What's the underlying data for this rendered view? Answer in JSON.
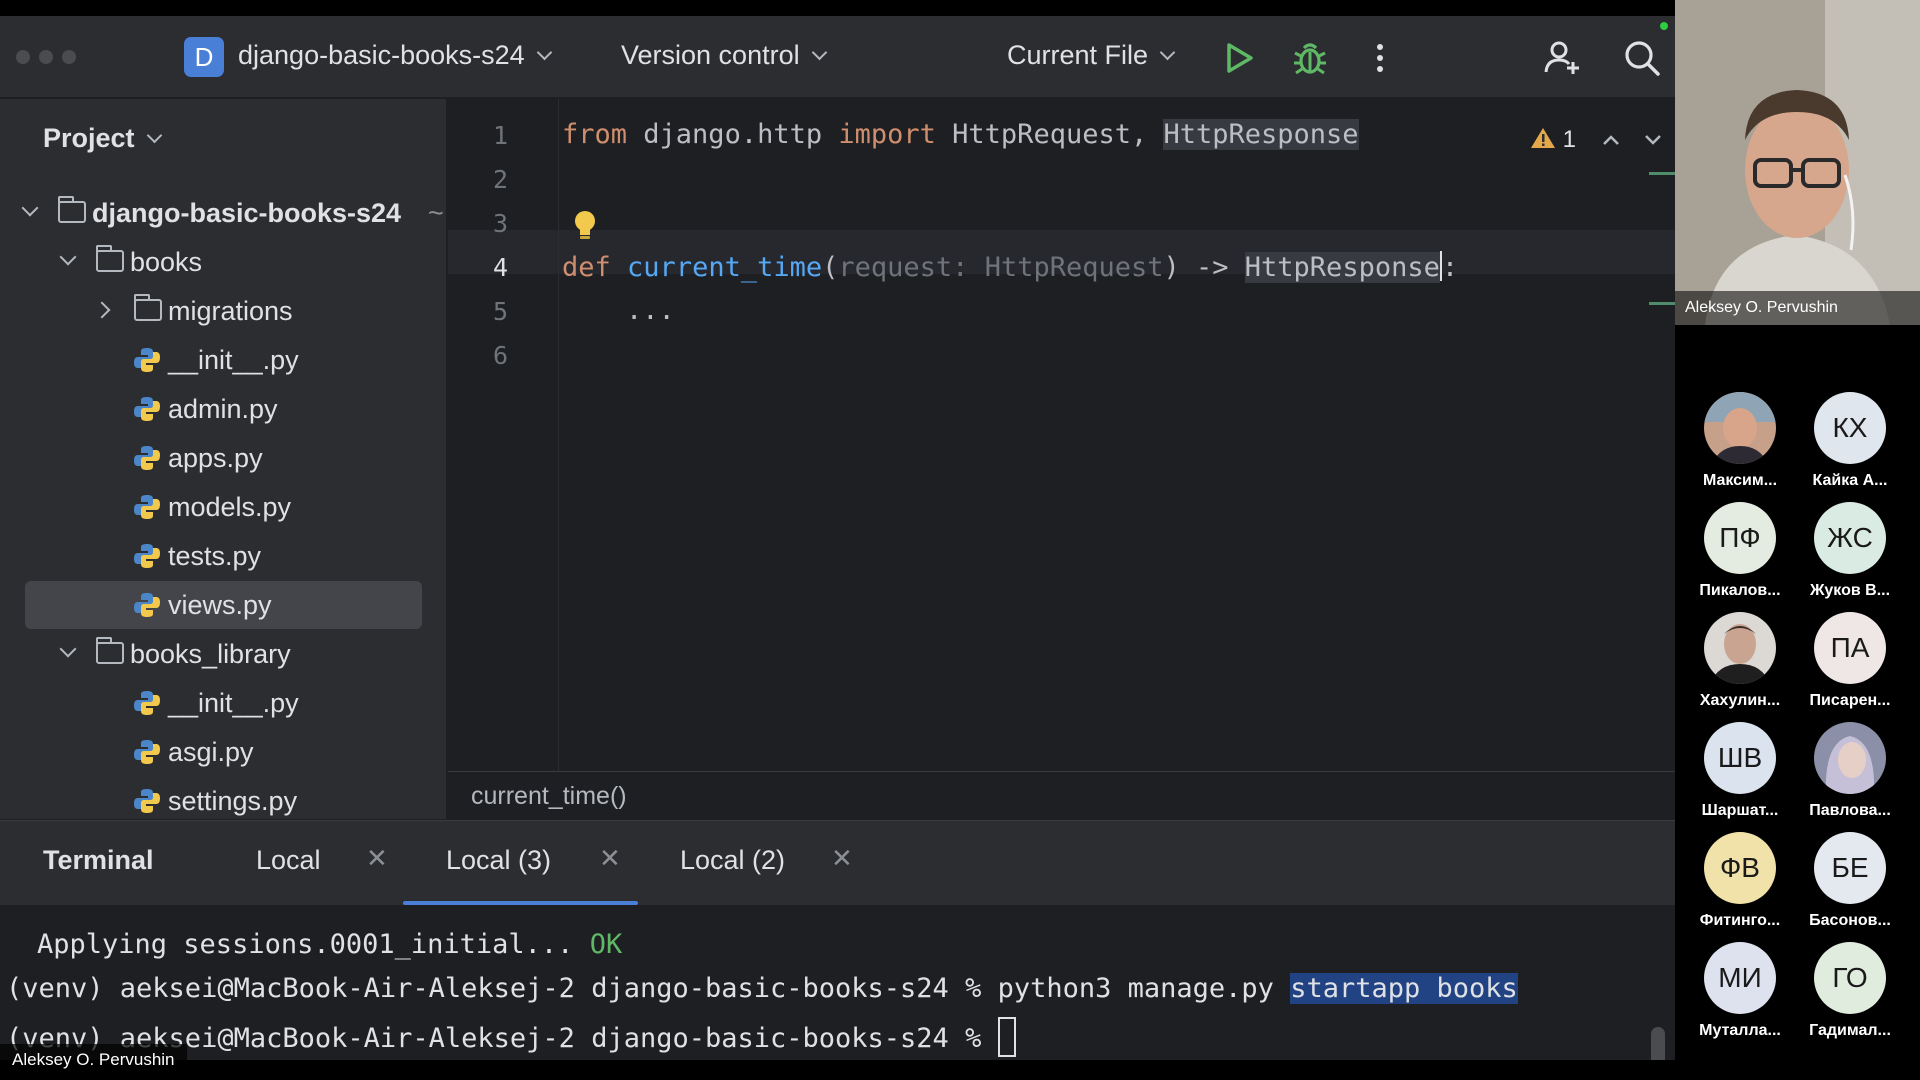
{
  "toolbar": {
    "project_badge": "D",
    "project_name": "django-basic-books-s24",
    "vcs_label": "Version control",
    "run_config": "Current File"
  },
  "project_panel": {
    "title": "Project",
    "root": {
      "label": "django-basic-books-s24",
      "suffix": "~"
    },
    "items": [
      {
        "label": "books"
      },
      {
        "label": "migrations"
      },
      {
        "label": "__init__.py"
      },
      {
        "label": "admin.py"
      },
      {
        "label": "apps.py"
      },
      {
        "label": "models.py"
      },
      {
        "label": "tests.py"
      },
      {
        "label": "views.py"
      },
      {
        "label": "books_library"
      },
      {
        "label": "__init__.py"
      },
      {
        "label": "asgi.py"
      },
      {
        "label": "settings.py"
      }
    ]
  },
  "editor": {
    "line_numbers": [
      "1",
      "2",
      "3",
      "4",
      "5",
      "6"
    ],
    "line1": {
      "from": "from",
      "module": " django.http ",
      "import": "import",
      "names": " HttpRequest, ",
      "hl_name": "HttpResponse"
    },
    "line4": {
      "def": "def",
      "space": " ",
      "fn": "current_time",
      "open": "(",
      "param": "request: HttpRequest",
      "close": ") -> ",
      "ret": "HttpResponse",
      "colon": ":"
    },
    "line5": "...",
    "warning_count": "1",
    "breadcrumb": "current_time()"
  },
  "terminal": {
    "title": "Terminal",
    "tabs": [
      {
        "label": "Local"
      },
      {
        "label": "Local (3)"
      },
      {
        "label": "Local (2)"
      }
    ],
    "line1_text": "Applying sessions.0001_initial... ",
    "line1_ok": "OK",
    "line2_prompt": "(venv) aeksei@MacBook-Air-Aleksej-2 django-basic-books-s24 % python3 manage.py ",
    "line2_selected": "startapp books",
    "line3_prompt": "(venv) aeksei@MacBook-Air-Aleksej-2 django-basic-books-s24 % "
  },
  "video": {
    "speaker_name": "Aleksey O. Pervushin",
    "bottom_name": "Aleksey O. Pervushin",
    "participants": [
      {
        "initials": "",
        "name": "Максим...",
        "color": "#c7a08a"
      },
      {
        "initials": "КХ",
        "name": "Кайка А...",
        "color": "#dfe6ee"
      },
      {
        "initials": "ПФ",
        "name": "Пикалов...",
        "color": "#e4ebe0"
      },
      {
        "initials": "ЖС",
        "name": "Жуков В...",
        "color": "#d9ebe3"
      },
      {
        "initials": "",
        "name": "Хахулин...",
        "color": "#c9c2bd"
      },
      {
        "initials": "ПА",
        "name": "Писарен...",
        "color": "#efe6e6"
      },
      {
        "initials": "ШВ",
        "name": "Шаршат...",
        "color": "#dbe4ee"
      },
      {
        "initials": "",
        "name": "Павлова...",
        "color": "#b9b6cc"
      },
      {
        "initials": "ФВ",
        "name": "Фитинго...",
        "color": "#f0e2a8"
      },
      {
        "initials": "БЕ",
        "name": "Басонов...",
        "color": "#e4e9ef"
      },
      {
        "initials": "МИ",
        "name": "Муталла...",
        "color": "#dde2ee"
      },
      {
        "initials": "ГО",
        "name": "Гадимал...",
        "color": "#e0ecdd"
      }
    ]
  }
}
